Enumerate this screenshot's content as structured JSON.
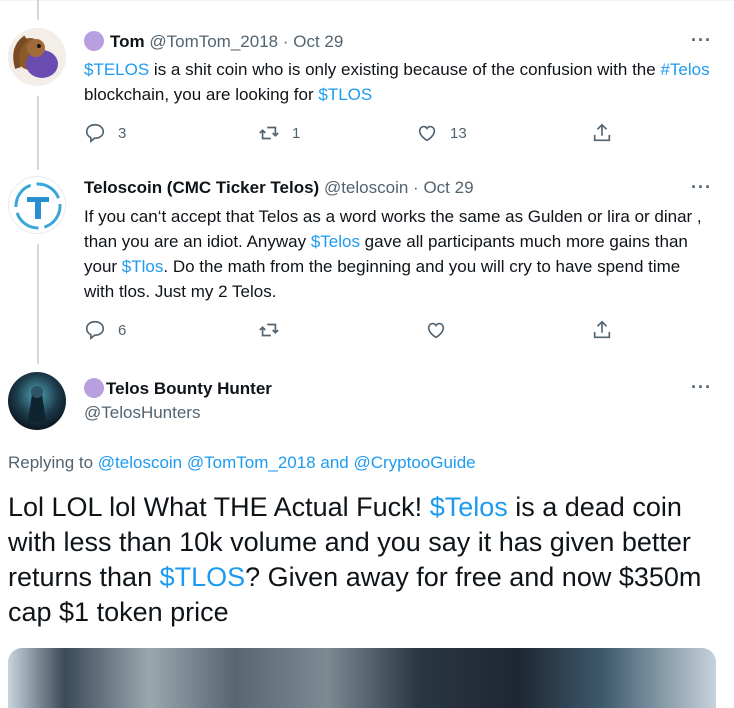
{
  "tweets": [
    {
      "name": "Tom",
      "handle": "@TomTom_2018",
      "sep": "·",
      "date": "Oct 29",
      "more": "···",
      "text": [
        {
          "t": "$TELOS",
          "link": true
        },
        {
          "t": " is a shit coin who is only existing because of the confusion with the ",
          "link": false
        },
        {
          "t": "#Telos",
          "link": true
        },
        {
          "t": " blockchain, you are looking for ",
          "link": false
        },
        {
          "t": "$TLOS",
          "link": true
        }
      ],
      "stats": {
        "replies": "3",
        "retweets": "1",
        "likes": "13"
      }
    },
    {
      "name": "Teloscoin (CMC Ticker Telos)",
      "handle": "@teloscoin",
      "sep": "·",
      "date": "Oct 29",
      "more": "···",
      "text": [
        {
          "t": "If you can‘t accept that Telos as a word works the same as Gulden or lira or dinar , than you are an idiot. Anyway ",
          "link": false
        },
        {
          "t": "$Telos",
          "link": true
        },
        {
          "t": " gave all participants much more gains than your ",
          "link": false
        },
        {
          "t": "$Tlos",
          "link": true
        },
        {
          "t": ". Do the math from the beginning and you will cry to have spend time with tlos. Just my 2 Telos.",
          "link": false
        }
      ],
      "stats": {
        "replies": "6",
        "retweets": "",
        "likes": ""
      }
    }
  ],
  "main": {
    "name": "Telos Bounty Hunter",
    "handle": "@TelosHunters",
    "more": "···",
    "replying_prefix": "Replying to ",
    "replying_to": [
      "@teloscoin",
      "@TomTom_2018"
    ],
    "replying_and": " and ",
    "replying_last": "@CryptooGuide",
    "text": [
      {
        "t": "Lol LOL lol What THE Actual Fuck! ",
        "link": false
      },
      {
        "t": "$Telos",
        "link": true
      },
      {
        "t": " is a dead coin with less than 10k volume and you say it has given better returns than ",
        "link": false
      },
      {
        "t": "$TLOS",
        "link": true
      },
      {
        "t": "? Given away for free and now $350m cap $1 token price",
        "link": false
      }
    ]
  },
  "colors": {
    "link": "#1d9bf0",
    "muted": "#536471",
    "text": "#0f1419",
    "badge": "#b79fe0"
  },
  "icons": [
    "reply-icon",
    "retweet-icon",
    "like-icon",
    "share-icon",
    "more-icon"
  ]
}
